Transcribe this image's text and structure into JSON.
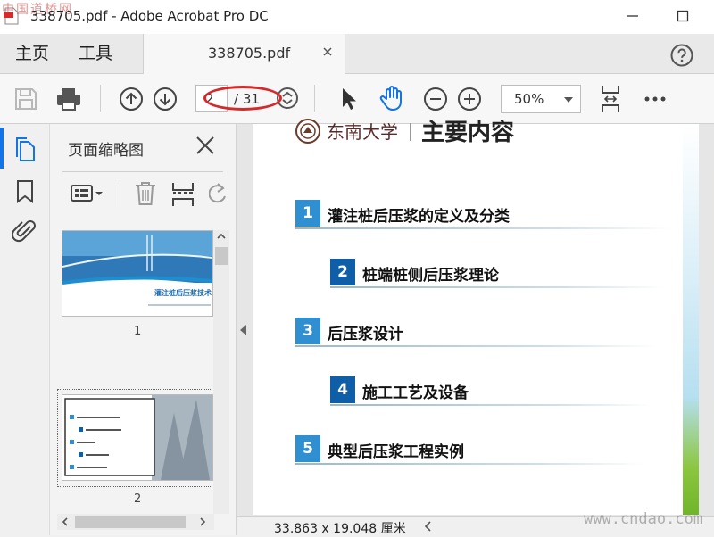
{
  "window": {
    "title": "338705.pdf - Adobe Acrobat Pro DC",
    "watermark_top": "中国道桥网",
    "watermark_bottom": "www.cndao.com"
  },
  "tabs": {
    "home": "主页",
    "tools": "工具",
    "document": "338705.pdf"
  },
  "toolbar": {
    "current_page": "2",
    "total_pages": "/ 31",
    "zoom": "50%"
  },
  "thumbnail_panel": {
    "title": "页面缩略图",
    "thumbnails": [
      {
        "label": "1",
        "caption": "灌注桩后压浆技术"
      },
      {
        "label": "2"
      }
    ]
  },
  "document": {
    "heading": "主要内容",
    "university": "东南大学",
    "toc": [
      {
        "num": "1",
        "text": "灌注桩后压浆的定义及分类"
      },
      {
        "num": "2",
        "text": "桩端桩侧后压浆理论"
      },
      {
        "num": "3",
        "text": "后压浆设计"
      },
      {
        "num": "4",
        "text": "施工工艺及设备"
      },
      {
        "num": "5",
        "text": "典型后压浆工程实例"
      }
    ]
  },
  "status": {
    "page_size": "33.863 x 19.048 厘米"
  },
  "colors": {
    "accent_blue": "#1473e6",
    "toc_light": "#2f8fd0",
    "toc_dark": "#0f5fa8",
    "annotation_red": "#d42a2a"
  },
  "icons": {
    "help": "help-circle-icon",
    "save": "save-icon",
    "print": "print-icon",
    "prev": "arrow-up-circle-icon",
    "next": "arrow-down-circle-icon",
    "select": "pointer-icon",
    "hand": "hand-icon",
    "zoom_out": "minus-circle-icon",
    "zoom_in": "plus-circle-icon",
    "fit": "fit-page-icon",
    "more": "more-icon"
  }
}
